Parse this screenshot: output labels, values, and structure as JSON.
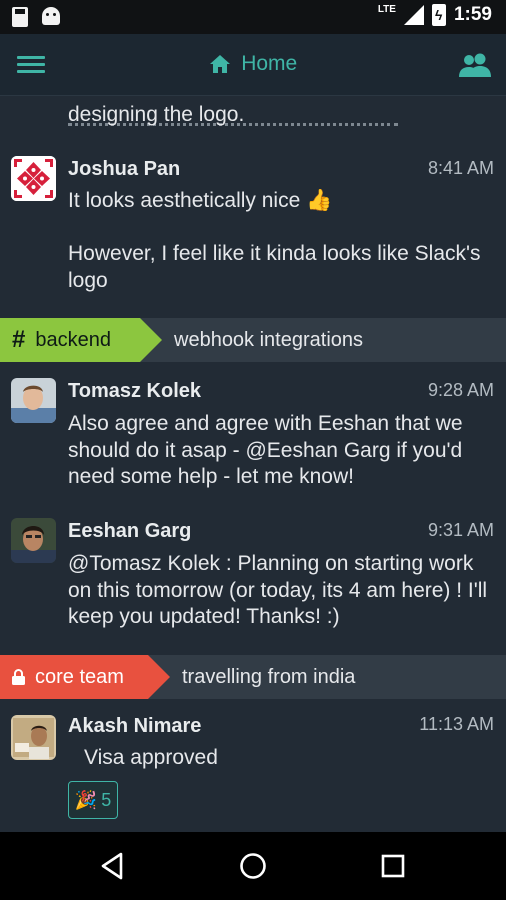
{
  "status_bar": {
    "time": "1:59",
    "network": "LTE"
  },
  "header": {
    "title": "Home"
  },
  "feed": {
    "partial_message": {
      "visible_text": "designing the logo."
    },
    "messages": [
      {
        "sender": "Joshua Pan",
        "time": "8:41 AM",
        "text": "It looks aesthetically nice 👍\n\nHowever, I feel like it kinda looks like Slack's logo"
      }
    ],
    "backend": {
      "channel": "backend",
      "topic": "webhook integrations",
      "messages": [
        {
          "sender": "Tomasz Kolek",
          "time": "9:28 AM",
          "text": "Also agree and agree with Eeshan that we should do it asap - @Eeshan Garg if you'd need some help - let me know!"
        },
        {
          "sender": "Eeshan Garg",
          "time": "9:31 AM",
          "text": "@Tomasz Kolek : Planning on starting work on this tomorrow (or today, its 4 am here) ! I'll keep you updated! Thanks! :)"
        }
      ]
    },
    "core_team": {
      "channel": "core team",
      "topic": "travelling from india",
      "messages": [
        {
          "sender": "Akash Nimare",
          "time": "11:13 AM",
          "text": "Visa approved",
          "reaction": {
            "emoji": "🎉",
            "count": "5"
          }
        }
      ]
    }
  },
  "colors": {
    "accent": "#3fb5a6",
    "backend_tag": "#8cc63f",
    "core_tag": "#e8513f",
    "feed_bg": "#222b35"
  }
}
